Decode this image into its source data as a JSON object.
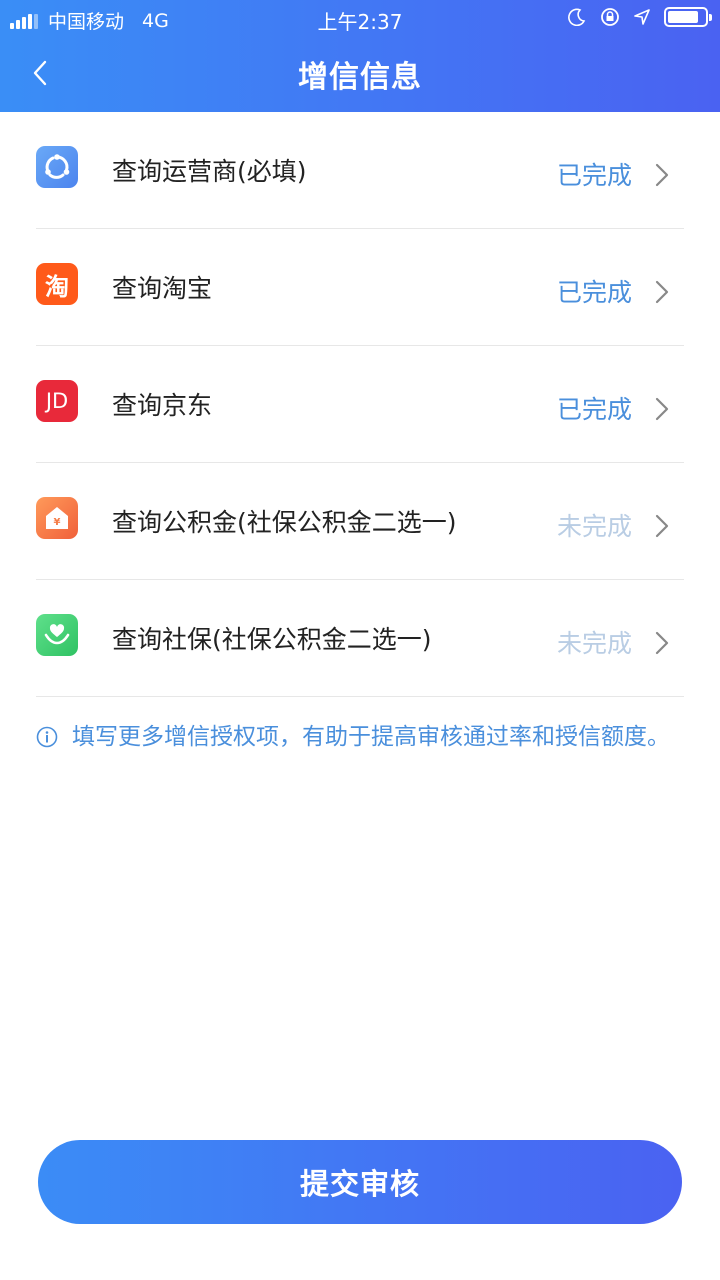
{
  "status_bar": {
    "carrier": "中国移动",
    "network": "4G",
    "time": "上午2:37"
  },
  "header": {
    "title": "增信信息",
    "background_colors": [
      "#3a8ef6",
      "#4a62f2"
    ]
  },
  "items": [
    {
      "label": "查询运营商(必填)",
      "status": "已完成",
      "icon": "carrier-icon",
      "icon_color": "#5b9cf2"
    },
    {
      "label": "查询淘宝",
      "status": "已完成",
      "icon": "taobao-icon",
      "icon_text": "淘",
      "icon_color": "#ff5a1a"
    },
    {
      "label": "查询京东",
      "status": "已完成",
      "icon": "jd-icon",
      "icon_text": "JD",
      "icon_color": "#e8293a"
    },
    {
      "label": "查询公积金(社保公积金二选一)",
      "status": "未完成",
      "icon": "housing-fund-icon",
      "icon_color": "#f57b45"
    },
    {
      "label": "查询社保(社保公积金二选一)",
      "status": "未完成",
      "icon": "social-security-icon",
      "icon_color": "#3ccf6e"
    }
  ],
  "colors": {
    "status_done": "#4a8fdc",
    "status_todo": "#b9cde4"
  },
  "tip": {
    "text": "填写更多增信授权项，有助于提高审核通过率和授信额度。"
  },
  "submit": {
    "label": "提交审核"
  }
}
